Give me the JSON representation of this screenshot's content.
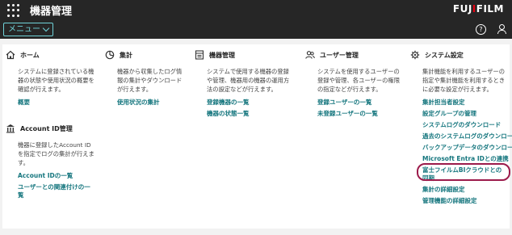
{
  "header": {
    "title": "機器管理",
    "logo": "FUJIFILM",
    "menu_label": "メニュー",
    "help_glyph": "?"
  },
  "columns": {
    "home": {
      "title": "ホーム",
      "desc": "システムに登録されている機器の状態や使用状況の概要を確認が行えます。",
      "links": [
        "概要"
      ]
    },
    "account": {
      "title": "Account ID管理",
      "desc": "機器に登録したAccount IDを指定でログの集計が行えます。",
      "links": [
        "Account IDの一覧",
        "ユーザーとの関連付けの一覧"
      ]
    },
    "aggregate": {
      "title": "集計",
      "desc": "機器から収集したログ情報の集計やダウンロードが行えます。",
      "links": [
        "使用状況の集計"
      ]
    },
    "devices": {
      "title": "機器管理",
      "desc": "システムで使用する機器の登録や管理、機器用の機器の運用方法の設定などが行えます。",
      "links": [
        "登録機器の一覧",
        "機器の状態一覧"
      ]
    },
    "users": {
      "title": "ユーザー管理",
      "desc": "システムを使用するユーザーの登録や管理、各ユーザーの権限の指定などが行えます。",
      "links": [
        "登録ユーザーの一覧",
        "未登録ユーザーの一覧"
      ]
    },
    "system": {
      "title": "システム設定",
      "desc": "集計機能を利用するユーザーの指定や集計機能を利用するときに必要な設定が行えます。",
      "links": [
        "集計担当者設定",
        "設定グループの管理",
        "システムログのダウンロード",
        "過去のシステムログのダウンロード",
        "バックアップデータのダウンロード",
        "Microsoft Entra IDとの連携",
        "富士フイルムBIクラウドとの同期",
        "集計の詳細設定",
        "管理機能の詳細設定"
      ]
    }
  },
  "colors": {
    "topbar": "#262626",
    "accent": "#6fd2d8",
    "link": "#15767e",
    "highlight": "#9c1b4b"
  }
}
